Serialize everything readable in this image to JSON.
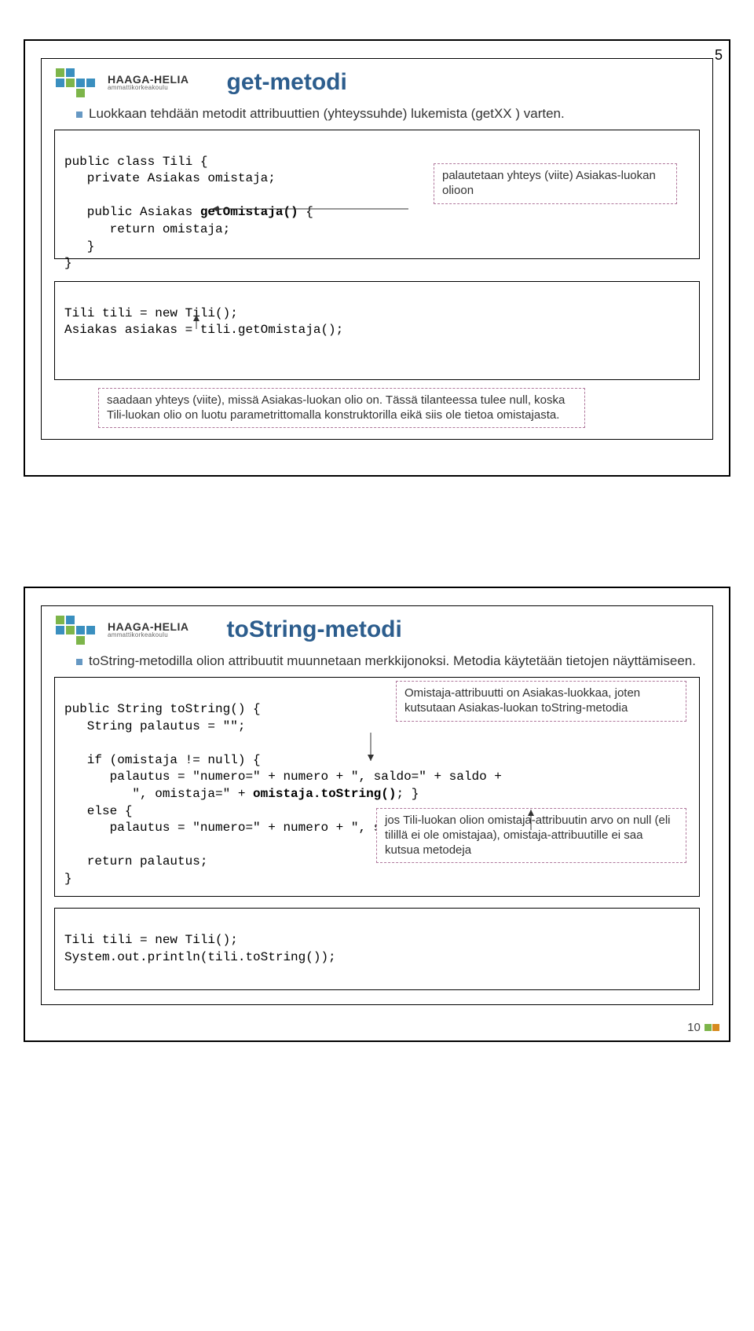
{
  "page_number": "5",
  "slide1": {
    "title": "get-metodi",
    "bullet": "Luokkaan tehdään metodit attribuuttien (yhteyssuhde) lukemista (getXX ) varten.",
    "code1_l1": "public class Tili {",
    "code1_l2": "   private Asiakas omistaja;",
    "code1_l3": "",
    "code1_l4a": "   public Asiakas ",
    "code1_l4b": "getOmistaja()",
    "code1_l4c": " {",
    "code1_l5": "      return omistaja;",
    "code1_l6": "   }",
    "code1_l7": "}",
    "callout_right": "palautetaan yhteys (viite) Asiakas-luokan olioon",
    "code2_l1": "Tili tili = new Tili();",
    "code2_l2": "Asiakas asiakas = tili.getOmistaja();",
    "callout_below": "saadaan yhteys (viite), missä Asiakas-luokan olio on. Tässä tilanteessa tulee null, koska Tili-luokan olio on luotu parametrittomalla konstruktorilla eikä siis ole tietoa omistajasta."
  },
  "slide2": {
    "title": "toString-metodi",
    "bullet": "toString-metodilla olion attribuutit muunnetaan merkkijonoksi. Metodia käytetään tietojen näyttämiseen.",
    "code1_l1": "public String toString() {",
    "code1_l2": "   String palautus = \"\";",
    "code1_l3": "",
    "code1_l4": "   if (omistaja != null) {",
    "code1_l5a": "      palautus = \"numero=\" + numero + \", saldo=\" + saldo +",
    "code1_l5b": "         \", omistaja=\" + ",
    "code1_l5c": "omistaja.toString()",
    "code1_l5d": "; }",
    "code1_l6": "   else {",
    "code1_l7": "      palautus = \"numero=\" + numero + \", saldo=\" + saldo ; }",
    "code1_l8": "",
    "code1_l9": "   return palautus;",
    "code1_l10": "}",
    "callout_right": "Omistaja-attribuutti on Asiakas-luokkaa, joten kutsutaan Asiakas-luokan toString-metodia",
    "callout_bottom": "jos Tili-luokan olion omistaja-attribuutin arvo on null (eli tilillä ei ole omistajaa), omistaja-attribuutille ei saa kutsua metodeja",
    "code2_l1": "Tili tili = new Tili();",
    "code2_l2": "System.out.println(tili.toString());",
    "slide_number": "10"
  },
  "logo": {
    "main": "HAAGA-HELIA",
    "sub": "ammattikorkeakoulu"
  }
}
